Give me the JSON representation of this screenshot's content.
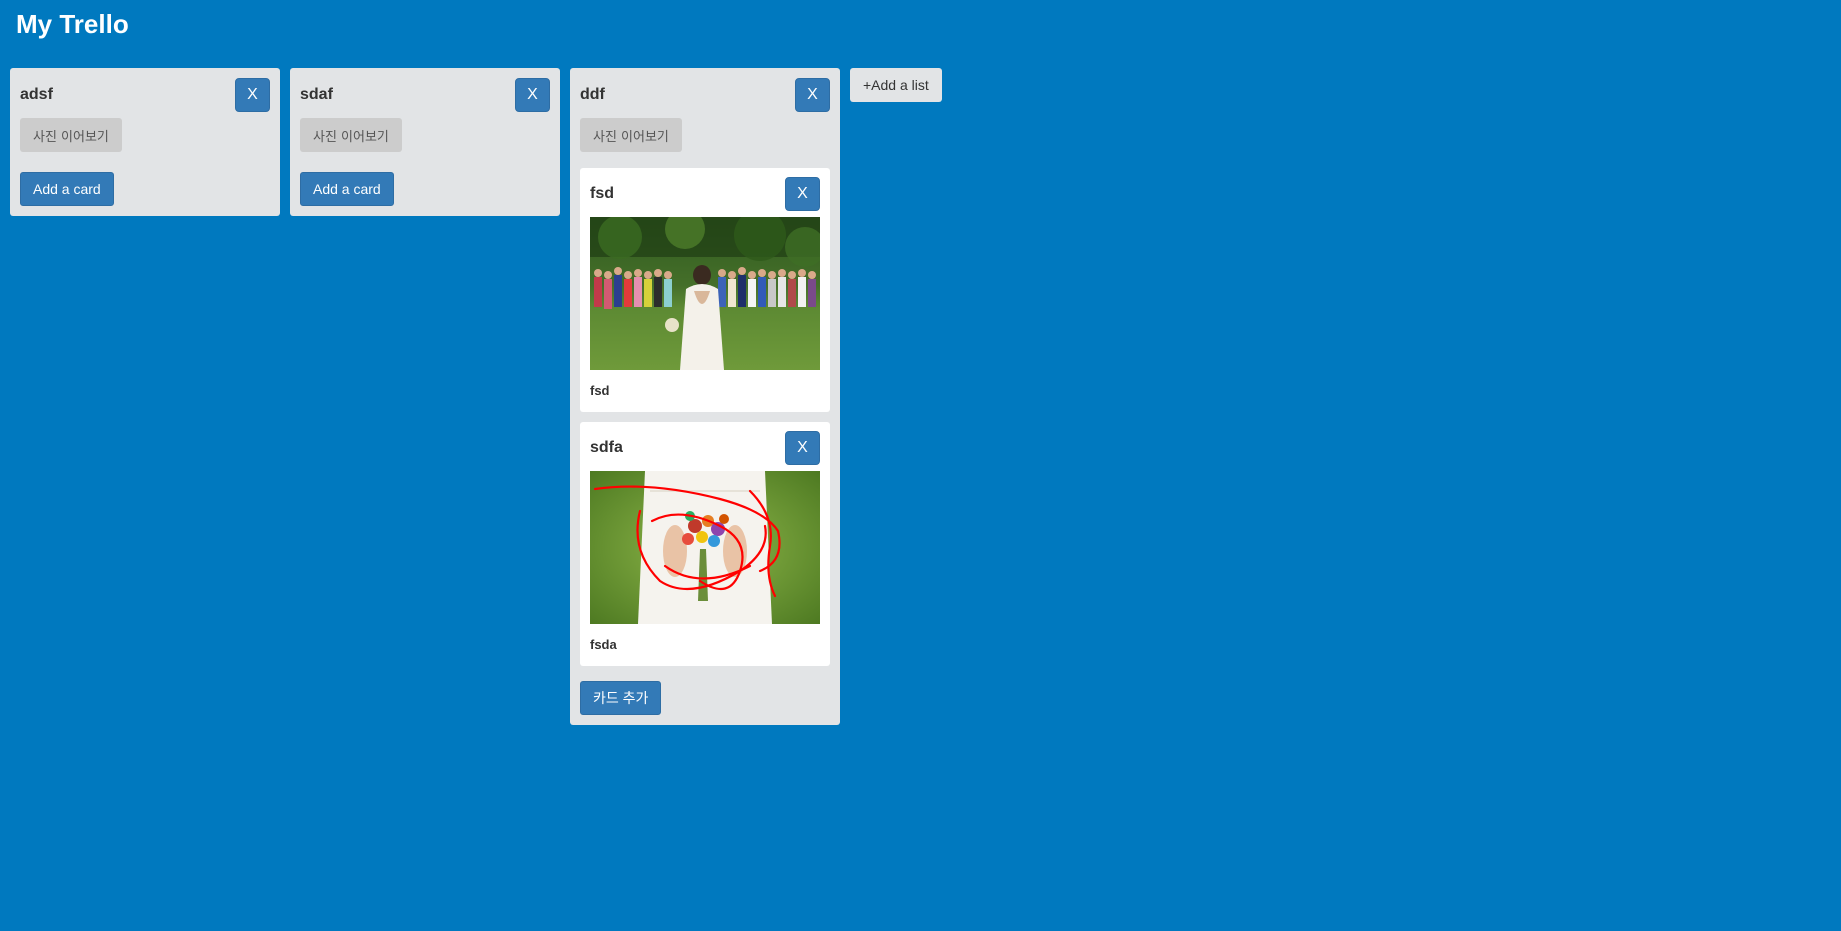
{
  "app": {
    "title": "My Trello"
  },
  "lists": [
    {
      "title": "adsf",
      "close_label": "X",
      "photo_button": "사진 이어보기",
      "add_label": "Add a card",
      "cards": []
    },
    {
      "title": "sdaf",
      "close_label": "X",
      "photo_button": "사진 이어보기",
      "add_label": "Add a card",
      "cards": []
    },
    {
      "title": "ddf",
      "close_label": "X",
      "photo_button": "사진 이어보기",
      "add_label": "카드 추가",
      "cards": [
        {
          "title": "fsd",
          "close_label": "X",
          "description": "fsd",
          "image": "wedding-crowd-photo"
        },
        {
          "title": "sdfa",
          "close_label": "X",
          "description": "fsda",
          "image": "bridal-bouquet-photo"
        }
      ]
    }
  ],
  "add_list_label": "+Add a list",
  "colors": {
    "board_background": "#0079bf",
    "list_background": "#e2e4e6",
    "primary_button": "#337ab7",
    "photo_button": "#cccccc"
  }
}
